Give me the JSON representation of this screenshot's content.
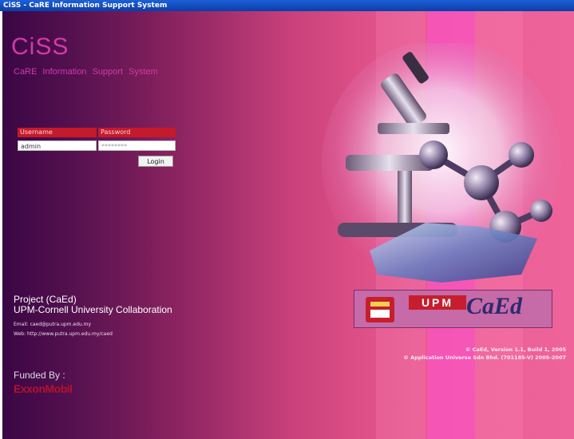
{
  "window": {
    "title": "CiSS - CaRE Information Support System"
  },
  "app": {
    "name": "CiSS",
    "subtitle": "CaRE Information Support System"
  },
  "login": {
    "username_label": "Username",
    "password_label": "Password",
    "username_value": "admin",
    "password_value": "********",
    "login_button": "Login"
  },
  "project": {
    "title": "Project (CaEd)",
    "collaboration": "UPM-Cornell University Collaboration",
    "email": "Email: caed@putra.upm.edu.my",
    "web": "Web: http://www.putra.upm.edu.my/caed"
  },
  "funding": {
    "label": "Funded By :",
    "sponsor": "ExxonMobil"
  },
  "logos": {
    "upm": "UPM",
    "caed": "CaEd"
  },
  "copyright": {
    "line1": "© CaEd, Version 1.1, Build 1, 2005",
    "line2": "© Application Universe Sdn Bhd. (701185-V) 2005-2007"
  },
  "colors": {
    "accent_title": "#d13aa8",
    "label_red": "#c5192c",
    "sponsor_red": "#b5122c",
    "titlebar_blue": "#1d5fd8"
  }
}
